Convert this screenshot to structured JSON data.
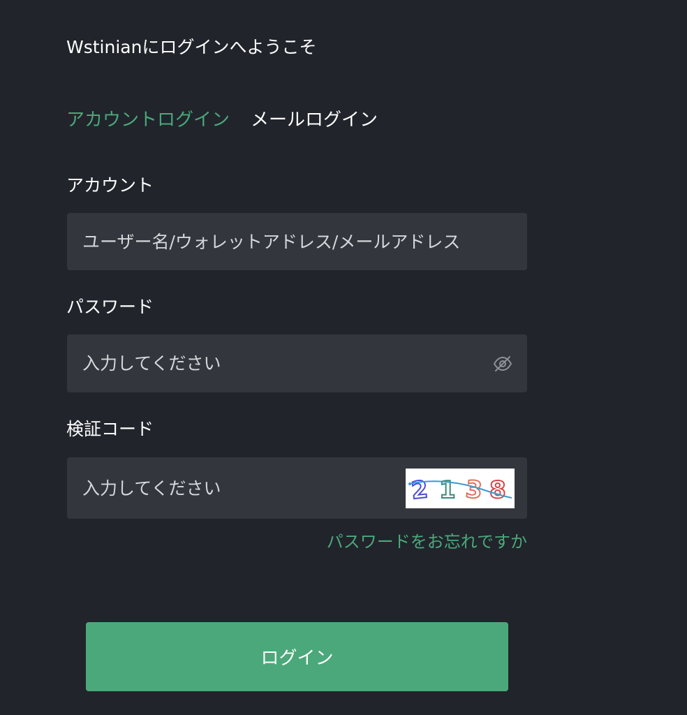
{
  "title": "Wstinianにログインへようこそ",
  "tabs": [
    {
      "label": "アカウントログイン",
      "active": true
    },
    {
      "label": "メールログイン",
      "active": false
    }
  ],
  "account": {
    "label": "アカウント",
    "placeholder": "ユーザー名/ウォレットアドレス/メールアドレス"
  },
  "password": {
    "label": "パスワード",
    "placeholder": "入力してください",
    "toggle_icon": "eye-slash-icon"
  },
  "captcha": {
    "label": "検証コード",
    "placeholder": "入力してください",
    "code": "2138"
  },
  "forgot_link": "パスワードをお忘れですか",
  "login_button": "ログイン",
  "colors": {
    "background": "#21242b",
    "field": "#33363d",
    "accent": "#4ba87a"
  }
}
